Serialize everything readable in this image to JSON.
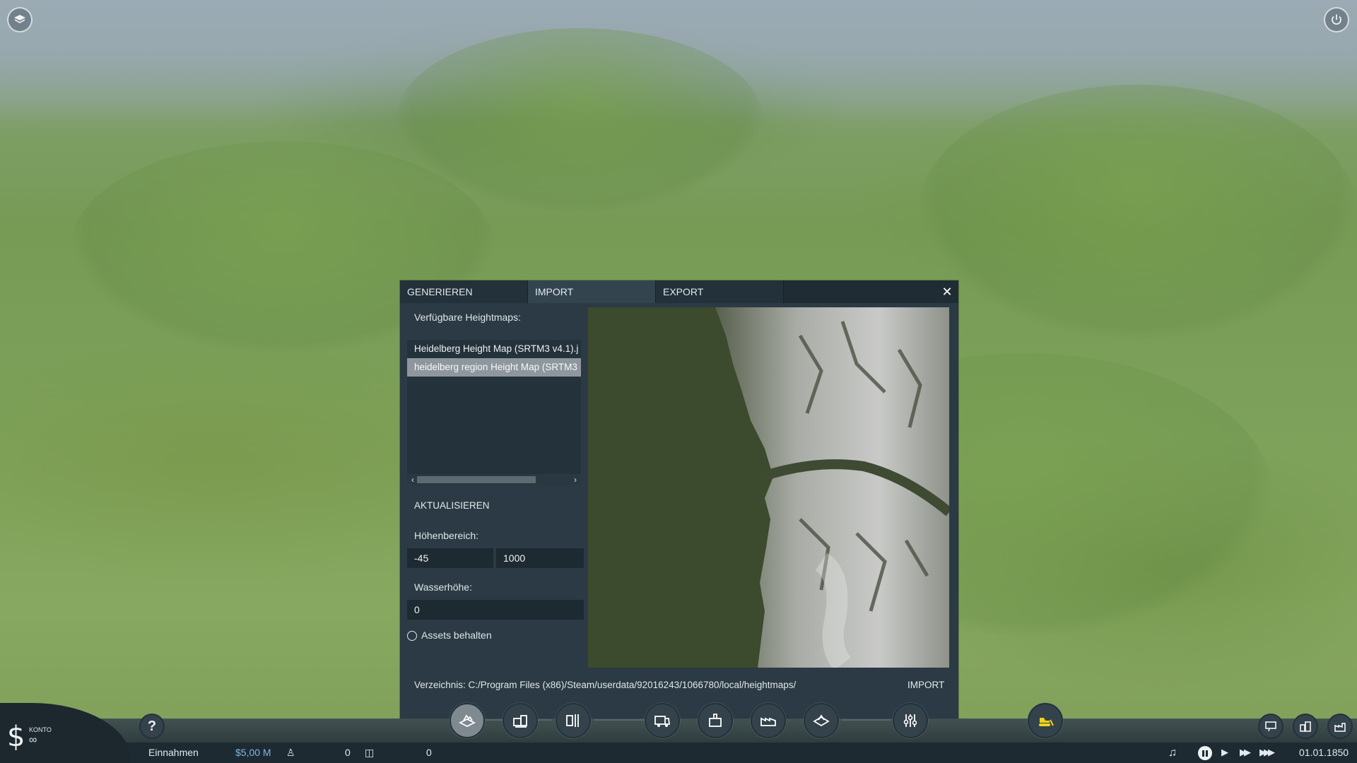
{
  "dialog": {
    "tabs": [
      {
        "label": "GENERIEREN",
        "active": false
      },
      {
        "label": "IMPORT",
        "active": true
      },
      {
        "label": "EXPORT",
        "active": false
      }
    ],
    "close_glyph": "✕",
    "available_label": "Verfügbare Heightmaps:",
    "heightmaps": [
      {
        "label": "Heidelberg Height Map (SRTM3 v4.1).j",
        "selected": false
      },
      {
        "label": "heidelberg region Height Map (SRTM3",
        "selected": true
      }
    ],
    "refresh_label": "AKTUALISIEREN",
    "height_range_label": "Höhenbereich:",
    "height_min": "-45",
    "height_max": "1000",
    "water_height_label": "Wasserhöhe:",
    "water_height": "0",
    "keep_assets_label": "Assets behalten",
    "keep_assets_checked": false,
    "directory_text": "Verzeichnis: C:/Program Files (x86)/Steam/userdata/92016243/1066780/local/heightmaps/",
    "import_button": "IMPORT"
  },
  "status": {
    "account_label": "KONTO",
    "account_value": "∞",
    "currency_symbol": "$",
    "income_label": "Einnahmen",
    "income_value": "$5,00 M",
    "passengers": "0",
    "cargo": "0",
    "date": "01.01.1850"
  },
  "toolbar": {
    "help_glyph": "?",
    "icons": [
      "terrain-icon",
      "town-building-icon",
      "train-station-icon",
      "vehicle-depot-icon",
      "town-icon",
      "industry-icon",
      "map-icon",
      "settings-sliders-icon",
      "bulldozer-icon"
    ]
  },
  "colors": {
    "dialog_bg": "#2b3a44",
    "selected_item": "#8e979d",
    "income": "#7fb6e0"
  }
}
